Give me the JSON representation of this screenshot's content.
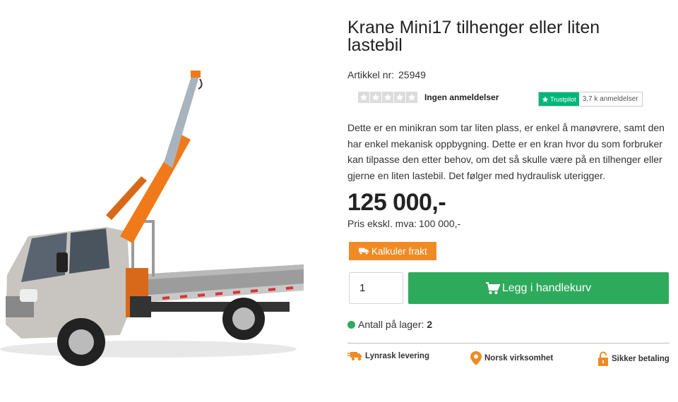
{
  "product": {
    "title": "Krane Mini17 tilhenger eller liten lastebil",
    "image_alt": "Lastebil med orange minikran",
    "sku_label": "Artikkel nr:",
    "sku": "25949",
    "rating": {
      "stars_filled": 0,
      "stars_total": 5,
      "label": "Ingen anmeldelser"
    },
    "trustpilot": {
      "brand": "Trustpilot",
      "count": "3,7 k anmeldelser"
    },
    "description": "Dette er en minikran som tar liten plass, er enkel å manøvrere, samt den har enkel mekanisk oppbygning. Dette er en kran hvor du som forbruker kan tilpasse den etter behov, om det så skulle være på en tilhenger eller gjerne en liten lastebil. Det følger med hydraulisk uterigger.",
    "price": "125 000,-",
    "price_ex_label": "Pris ekskl. mva:",
    "price_ex": "100 000,-",
    "shipping_button": "Kalkuler frakt",
    "quantity": "1",
    "add_to_cart": "Legg i handlekurv",
    "stock_label": "Antall på lager:",
    "stock_count": "2"
  },
  "usps": [
    {
      "label": "Lynrask levering",
      "icon": "truck-icon"
    },
    {
      "label": "Norsk virksomhet",
      "icon": "map-pin-icon"
    },
    {
      "label": "Sikker betaling",
      "icon": "lock-icon"
    }
  ],
  "colors": {
    "accent_orange": "#f08a24",
    "cart_green": "#2eaa5c",
    "trustpilot_green": "#00b67a"
  }
}
